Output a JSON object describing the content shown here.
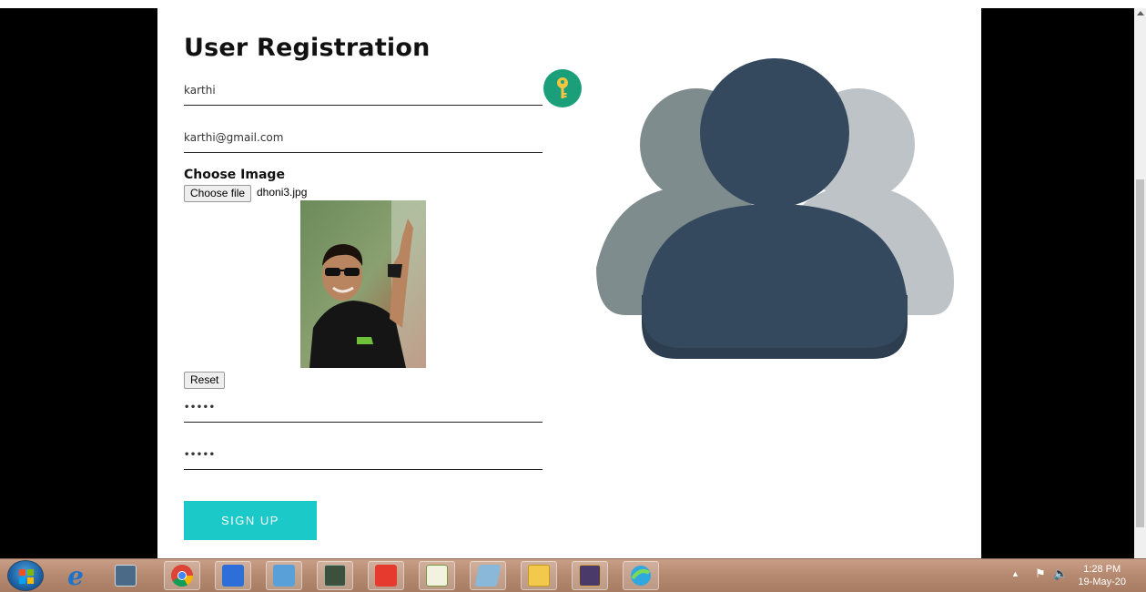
{
  "form": {
    "title": "User Registration",
    "name_value": "karthi",
    "email_value": "karthi@gmail.com",
    "choose_image_label": "Choose Image",
    "choose_file_button": "Choose file",
    "file_name": "dhoni3.jpg",
    "reset_button": "Reset",
    "password_value": "•••••",
    "confirm_password_value": "•••••",
    "signup_button": "SIGN UP"
  },
  "colors": {
    "signup_bg": "#1cc9c9",
    "key_button_bg": "#1a9f7a",
    "users_front": "#34495e",
    "users_mid": "#7f8c8d",
    "users_back": "#bdc3c7"
  },
  "icons": {
    "key_button": "key-icon",
    "illustration": "users-group-icon"
  },
  "taskbar": {
    "items": [
      "ie-icon",
      "calculator-icon",
      "chrome-icon",
      "wps-icon",
      "control-panel-icon",
      "terminal-icon",
      "anydesk-icon",
      "chart-app-icon",
      "notes-icon",
      "file-explorer-icon",
      "java-ee-ide-icon",
      "network-icon"
    ],
    "time": "1:28 PM",
    "date": "19-May-20"
  }
}
